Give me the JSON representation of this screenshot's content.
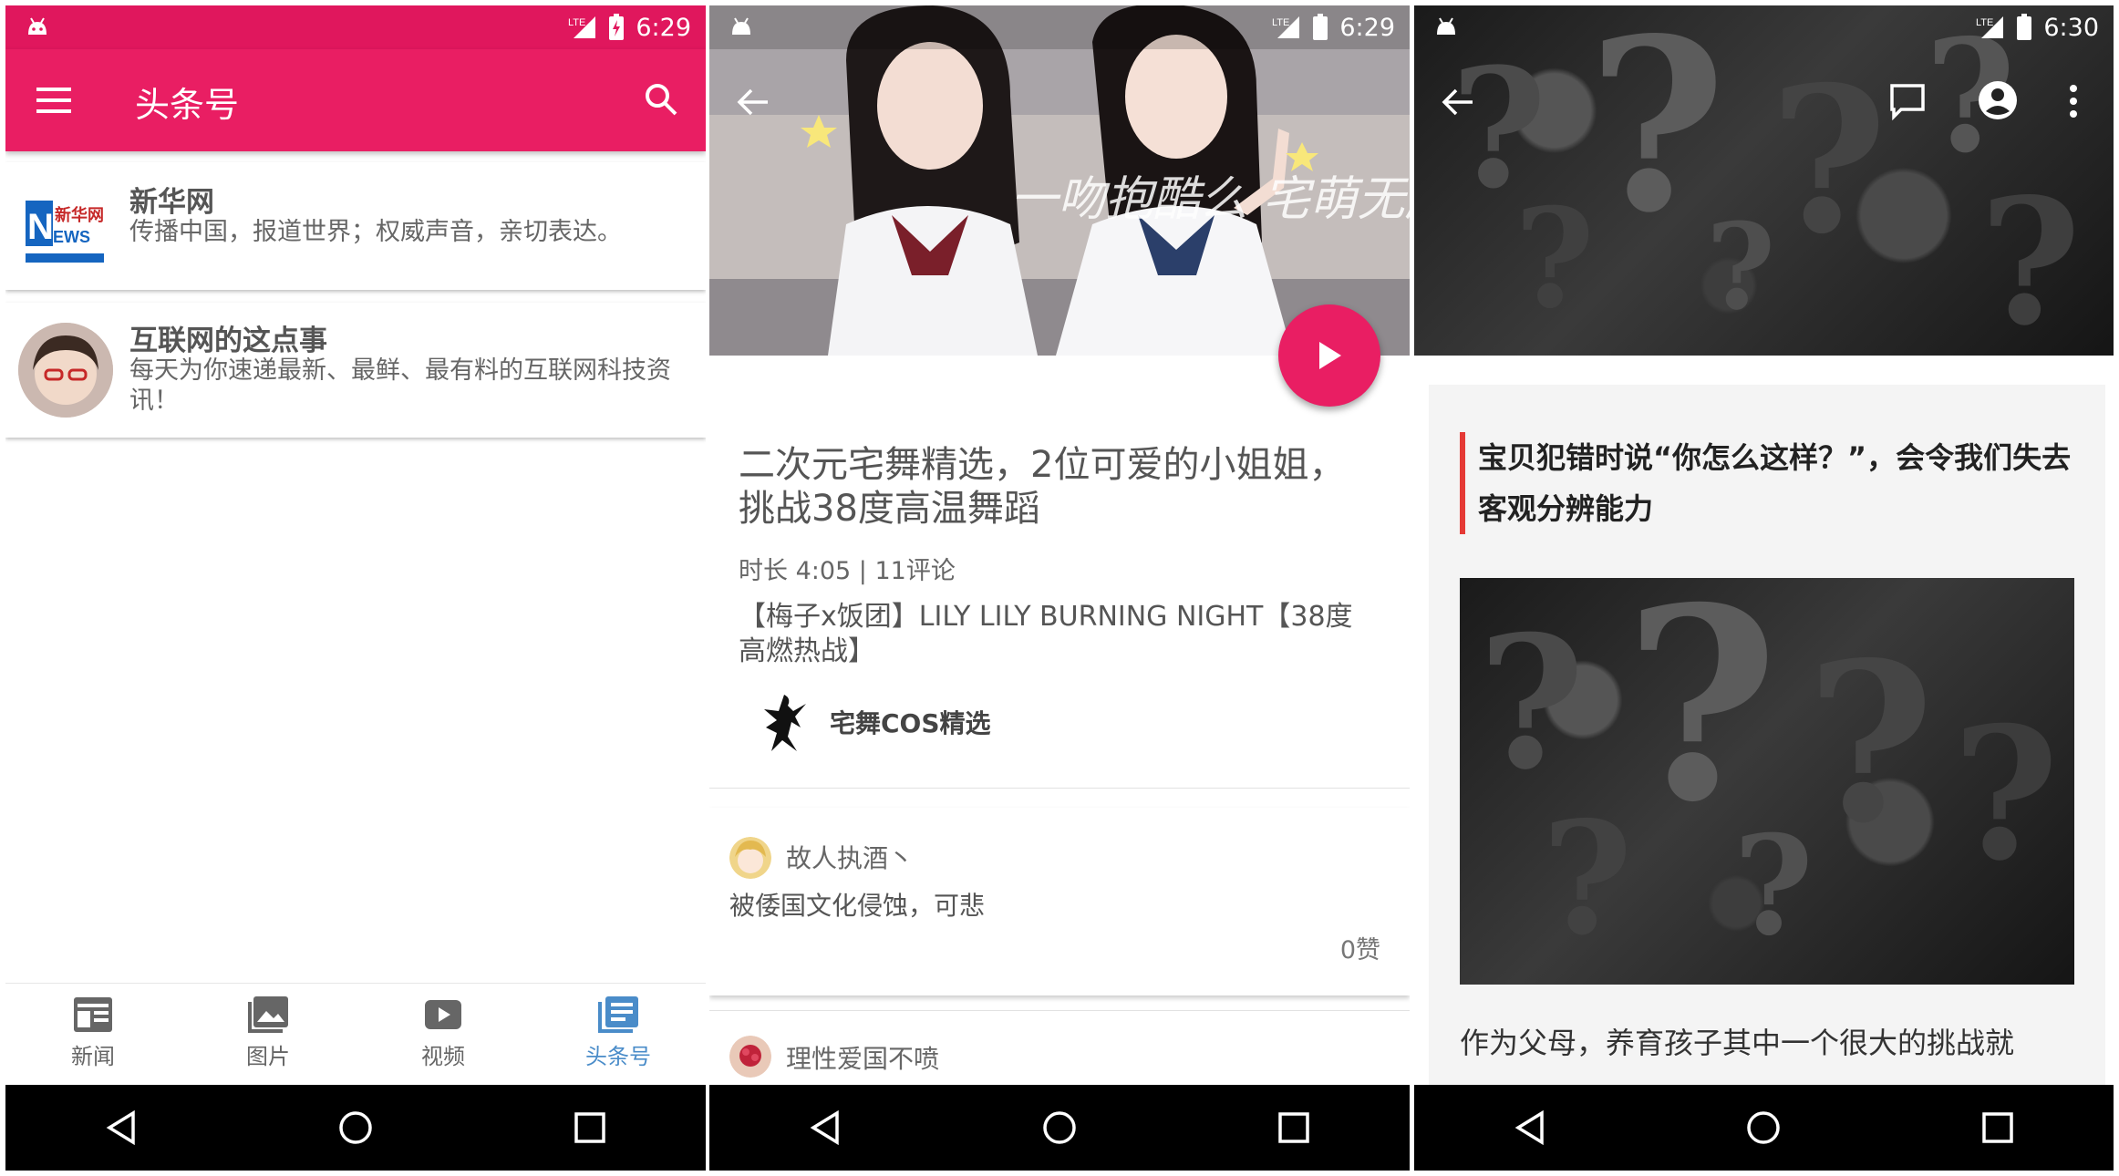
{
  "statusbar": {
    "s1_time": "6:29",
    "s2_time": "6:29",
    "s3_time": "6:30",
    "network": "LTE"
  },
  "screen1": {
    "title": "头条号",
    "accent": "#e91e63",
    "cards": [
      {
        "name": "新华网",
        "desc": "传播中国，报道世界；权威声音，亲切表达。"
      },
      {
        "name": "互联网的这点事",
        "desc": "每天为你速递最新、最鲜、最有料的互联网科技资讯！"
      }
    ],
    "bottomnav": [
      {
        "label": "新闻",
        "icon": "news-icon"
      },
      {
        "label": "图片",
        "icon": "image-icon"
      },
      {
        "label": "视频",
        "icon": "video-icon"
      },
      {
        "label": "头条号",
        "icon": "toutiao-icon",
        "active": true
      }
    ]
  },
  "screen2": {
    "hero_caption": "一吻抱酷么 宅萌无所不能",
    "title": "二次元宅舞精选，2位可爱的小姐姐，挑战38度高温舞蹈",
    "meta": "时长 4:05 | 11评论",
    "desc": "【梅子x饭团】LILY LILY BURNING NIGHT【38度高燃热战】",
    "author": "宅舞COS精选",
    "comments": [
      {
        "user": "故人执酒丶",
        "text": "被倭国文化侵蚀，可悲",
        "likes": "0赞"
      },
      {
        "user": "理性爱国不喷"
      }
    ]
  },
  "screen3": {
    "title": "宝贝犯错时说“你怎么这样？”，会令我们失去客观分辨能力",
    "body": "作为父母，养育孩子其中一个很大的挑战就"
  }
}
